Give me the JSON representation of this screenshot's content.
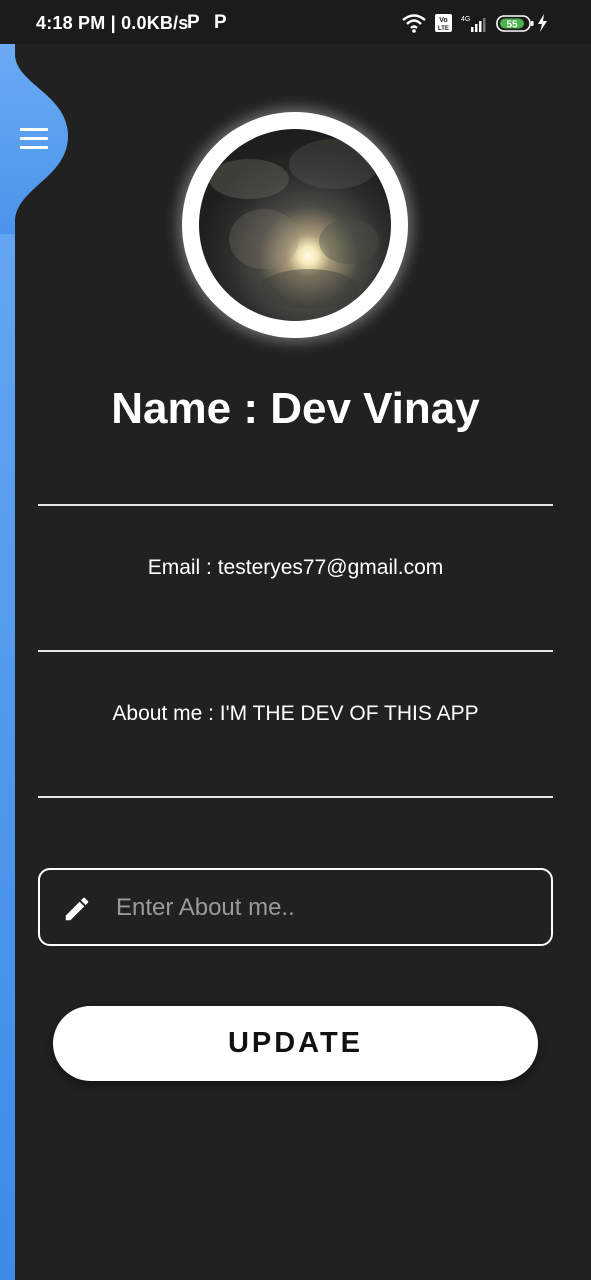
{
  "status_bar": {
    "time_speed": "4:18 PM | 0.0KB/s",
    "notif_icon_1": "P",
    "notif_icon_2": "P",
    "volte_label": "Vo LTE",
    "network_label": "4G",
    "battery_level": "55"
  },
  "drawer": {
    "menu_icon": "hamburger-menu-icon",
    "accent_color": "#4a94ec"
  },
  "profile": {
    "avatar": "moon-night-photo",
    "name_line": "Name : Dev Vinay",
    "email_line": "Email : testeryes77@gmail.com",
    "about_line": "About me : I'M THE DEV OF THIS APP"
  },
  "form": {
    "about_placeholder": "Enter About me..",
    "about_value": "",
    "input_icon": "pencil-icon",
    "update_label": "UPDATE"
  },
  "colors": {
    "background": "#212121",
    "status_bar": "#1b1b1b",
    "text": "#ffffff",
    "button_bg": "#ffffff",
    "button_text": "#111111"
  }
}
